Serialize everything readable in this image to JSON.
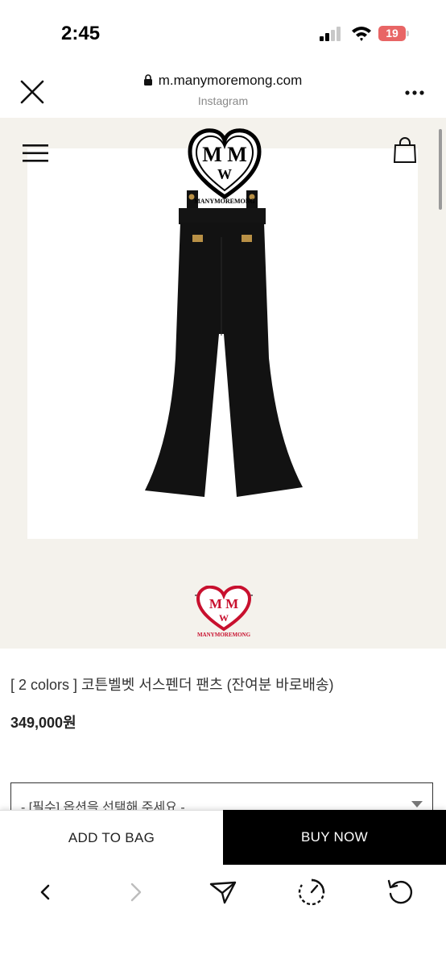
{
  "status_bar": {
    "time": "2:45",
    "battery": "19"
  },
  "browser": {
    "url": "m.manymoremong.com",
    "source": "Instagram"
  },
  "brand": {
    "logo_text": "MANYMOREMONG",
    "logo_colors": [
      "#000000",
      "#c8102e"
    ]
  },
  "product": {
    "name": "[ 2 colors ] 코튼벨벳 서스펜더 팬츠 (잔여분 바로배송)",
    "price": "349,000원",
    "option_placeholder": "- [필수] 옵션을 선택해 주세요 -"
  },
  "actions": {
    "add_to_bag": "ADD TO BAG",
    "buy_now": "BUY NOW"
  },
  "toolbar": [
    "back-icon",
    "forward-icon",
    "share-icon",
    "speed-icon",
    "reload-icon"
  ],
  "colors": {
    "accent": "#000000",
    "hero_bg": "#f4f2ec",
    "battery": "#e86565"
  }
}
